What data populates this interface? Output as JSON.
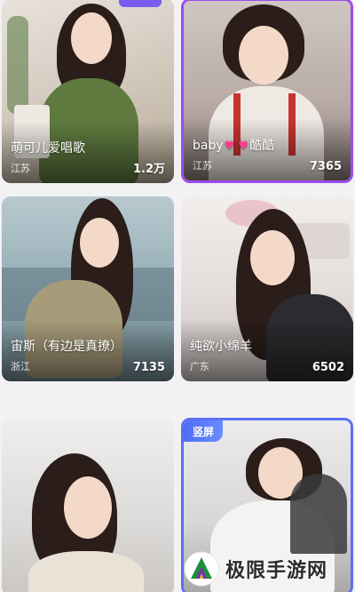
{
  "cards": [
    {
      "title": "萌可儿爱唱歌",
      "location": "江苏",
      "count": "1.2万"
    },
    {
      "title_prefix": "baby",
      "hearts": "♥ ♥",
      "title_suffix": "酷酷",
      "location": "江苏",
      "count": "7365"
    },
    {
      "title": "宙斯（有边是真撩）",
      "location": "浙江",
      "count": "7135"
    },
    {
      "title": "纯欲小绵羊",
      "location": "广东",
      "count": "6502"
    },
    {
      "title": "",
      "location": "",
      "count": ""
    },
    {
      "badge": "竖屏",
      "title": "",
      "location": "",
      "count": ""
    }
  ],
  "watermark": {
    "text": "极限手游网",
    "icon": "mountain-logo-icon"
  },
  "colors": {
    "accent_purple": "#9b4cf0",
    "accent_blue": "#5b6ff5",
    "heart": "#ff3d8e"
  }
}
